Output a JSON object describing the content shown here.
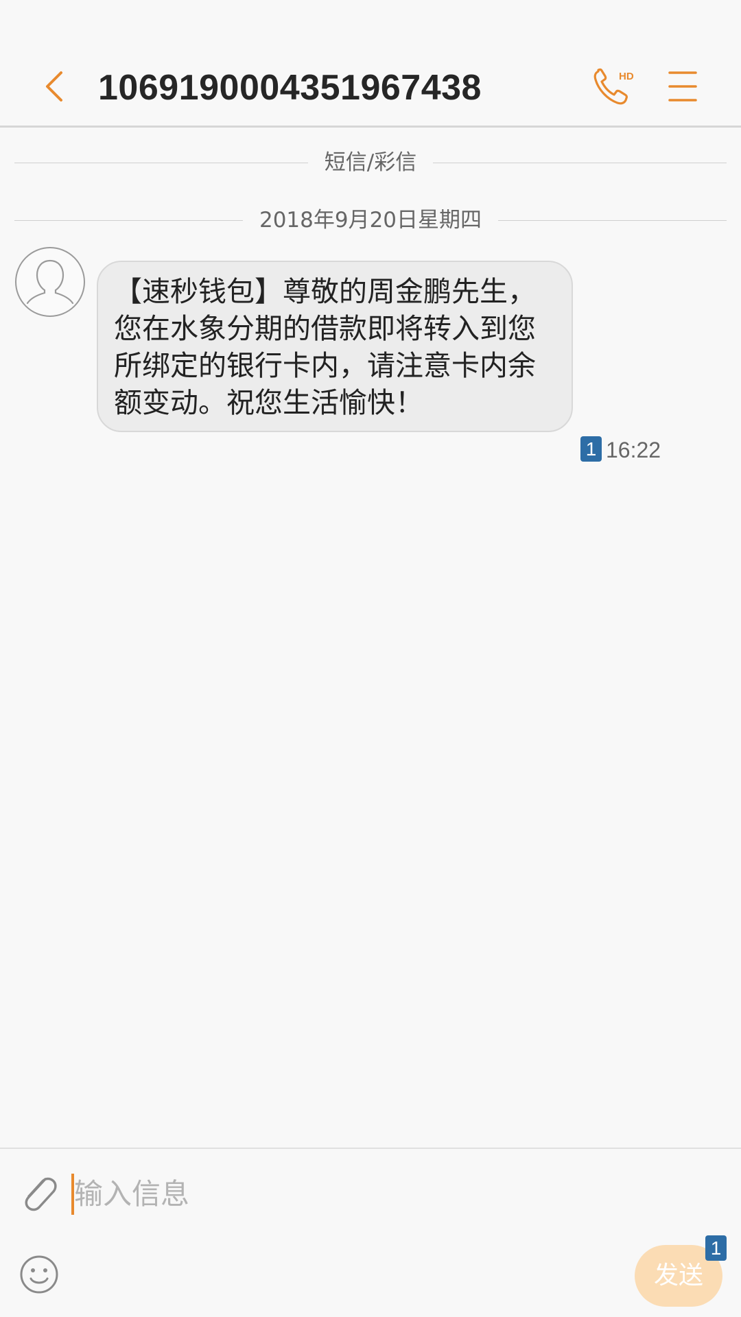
{
  "header": {
    "title": "10691900043519674​38",
    "back_icon": "chevron-left-icon",
    "call_icon": "hd-phone-icon",
    "call_badge": "HD",
    "menu_icon": "menu-icon"
  },
  "conversation": {
    "channel_label": "短信/彩信",
    "date_label": "2018年9月20日星期四",
    "messages": [
      {
        "text": "【速秒钱包】尊敬的周金鹏先生，您在水象分期的借款即将转入到您所绑定的银行卡内，请注意卡内余额变动。祝您生活愉快！",
        "sim": "1",
        "time": "16:22"
      }
    ]
  },
  "composer": {
    "placeholder": "输入信息",
    "send_label": "发送",
    "send_sim": "1",
    "attach_icon": "paperclip-icon",
    "emoji_icon": "smiley-icon"
  },
  "colors": {
    "accent": "#e88a2e",
    "sim_badge": "#2d6da6",
    "bubble": "#ececec",
    "background": "#f8f8f8",
    "send_disabled": "#fbdcb4"
  }
}
